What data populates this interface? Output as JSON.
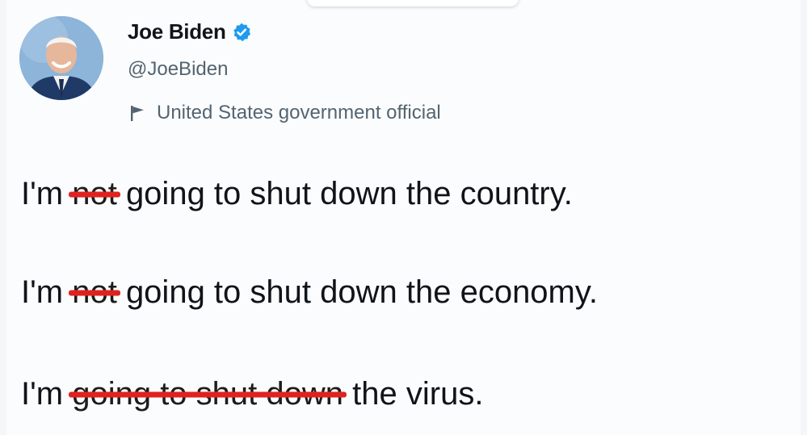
{
  "tweet": {
    "author_name": "Joe Biden",
    "handle": "@JoeBiden",
    "label": "United States government official",
    "verified_icon": "verified-badge-icon",
    "label_icon": "flag-icon",
    "lines": [
      {
        "prefix": "I'm",
        "struck": "not",
        "rest": "going to shut down the country."
      },
      {
        "prefix": "I'm",
        "struck": "not",
        "rest": "going to shut down the economy."
      },
      {
        "prefix": "I'm",
        "struck": "going to shut down",
        "rest": "the virus."
      }
    ]
  },
  "colors": {
    "strike": "#e0221f",
    "verified": "#1d9bf0",
    "secondary_text": "#536471"
  }
}
